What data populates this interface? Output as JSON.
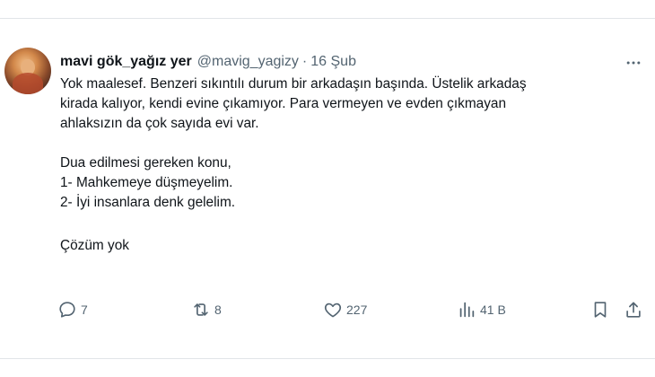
{
  "tweet": {
    "author_name": "mavi gök_yağız yer",
    "author_handle": "@mavig_yagizy",
    "separator": "·",
    "date": "16 Şub",
    "text_lines": [
      "Yok maalesef. Benzeri sıkıntılı durum bir arkadaşın başında. Üstelik arkadaş",
      "kirada kalıyor, kendi evine çıkamıyor. Para vermeyen ve evden çıkmayan",
      "ahlaksızın da çok sayıda evi var.",
      "Dua edilmesi gereken konu,",
      "1-  Mahkemeye düşmeyelim.",
      "2- İyi insanlara denk gelelim.",
      "Çözüm yok"
    ]
  },
  "actions": {
    "reply_count": "7",
    "retweet_count": "8",
    "like_count": "227",
    "views_count": "41 B"
  },
  "icons": {
    "avatar": "profile-photo",
    "more": "more-horizontal-icon",
    "reply": "reply-icon",
    "retweet": "retweet-icon",
    "like": "heart-icon",
    "views": "analytics-icon",
    "bookmark": "bookmark-icon",
    "share": "share-icon"
  },
  "colors": {
    "text": "#0f1419",
    "secondary": "#536471",
    "divider": "#e1e5e8"
  }
}
